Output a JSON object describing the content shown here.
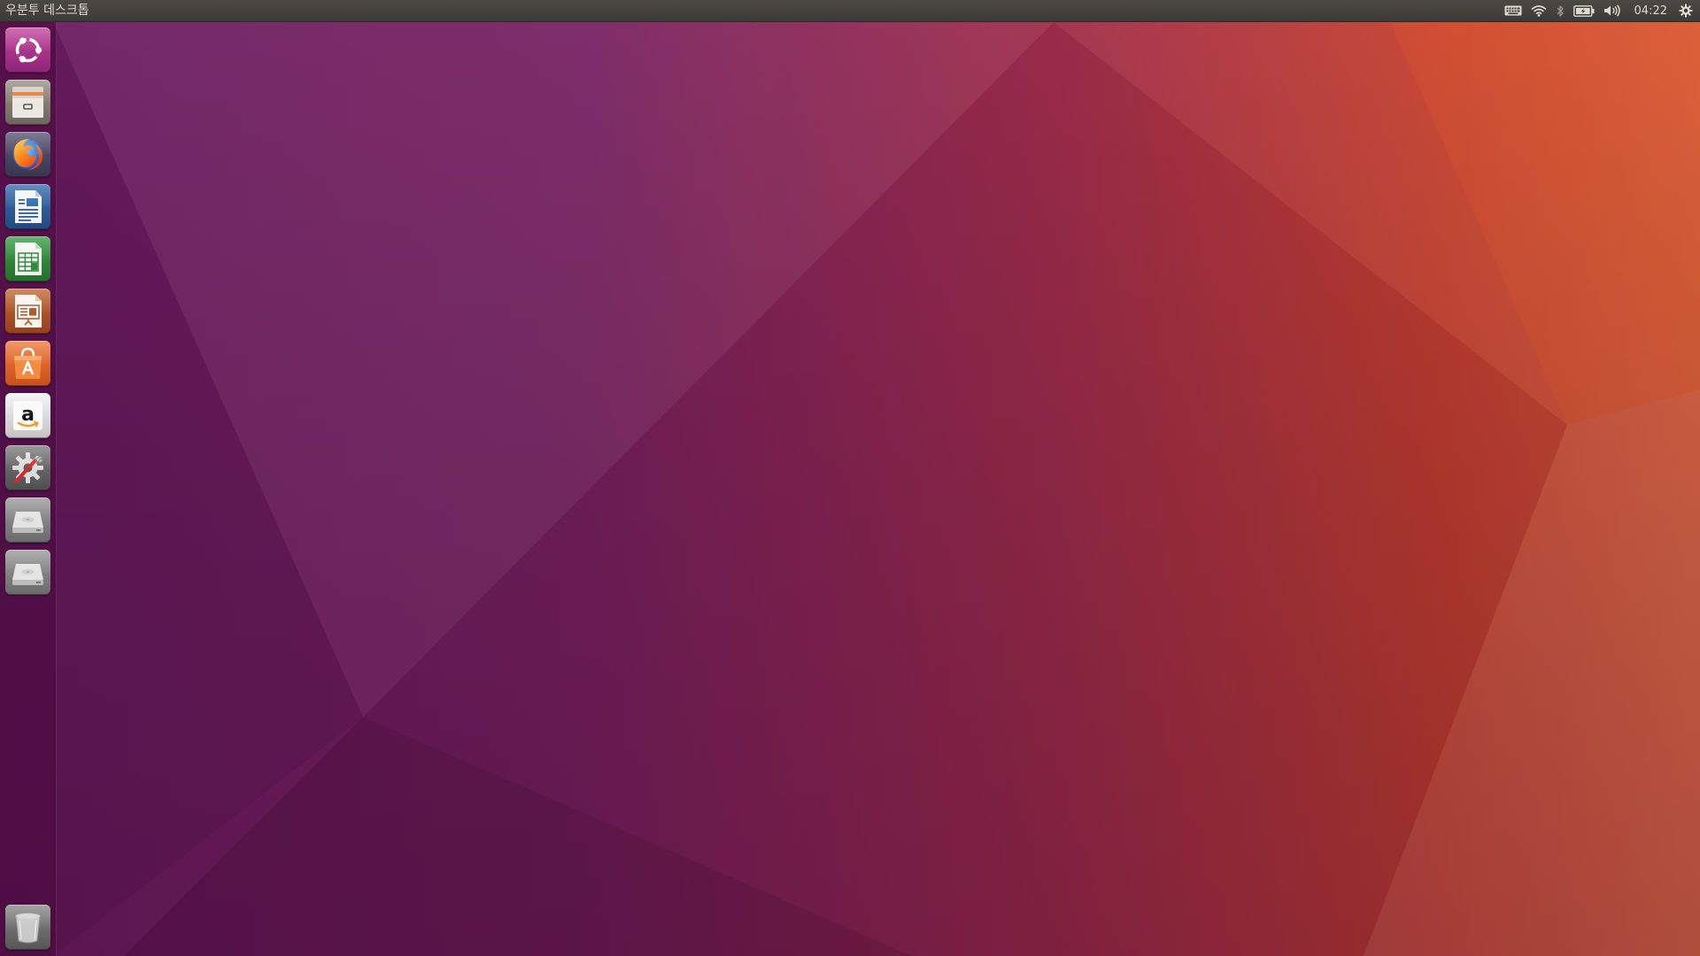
{
  "top_panel": {
    "title": "우분투 데스크톱",
    "clock": "04:22",
    "indicators": [
      {
        "name": "keyboard-icon"
      },
      {
        "name": "wifi-icon"
      },
      {
        "name": "bluetooth-icon"
      },
      {
        "name": "battery-icon"
      },
      {
        "name": "volume-icon"
      },
      {
        "name": "gear-icon"
      }
    ]
  },
  "launcher": {
    "items": [
      {
        "name": "ubuntu-dash-icon",
        "tile_color": "#b3378f"
      },
      {
        "name": "files-icon",
        "tile_color": "#8a8278"
      },
      {
        "name": "firefox-icon",
        "tile_color": "#4f4a6d"
      },
      {
        "name": "libreoffice-writer-icon",
        "tile_color": "#2d5d9a"
      },
      {
        "name": "libreoffice-calc-icon",
        "tile_color": "#2f8a3a"
      },
      {
        "name": "libreoffice-impress-icon",
        "tile_color": "#b4582a"
      },
      {
        "name": "software-center-icon",
        "tile_color": "#e0642a"
      },
      {
        "name": "amazon-icon",
        "tile_color": "#d8d8d8"
      },
      {
        "name": "system-settings-icon",
        "tile_color": "#6b6b6b"
      },
      {
        "name": "drive-icon",
        "tile_color": "#8c8c8c"
      },
      {
        "name": "drive-icon",
        "tile_color": "#8c8c8c"
      },
      {
        "name": "trash-icon",
        "tile_color": "#6f6f6f"
      }
    ]
  },
  "colors": {
    "wallpaper_start": "#6c1f63",
    "wallpaper_mid": "#8e2b57",
    "wallpaper_end": "#d4502e",
    "panel_bg": "#3c3b37",
    "panel_text": "#dfdbd2"
  }
}
